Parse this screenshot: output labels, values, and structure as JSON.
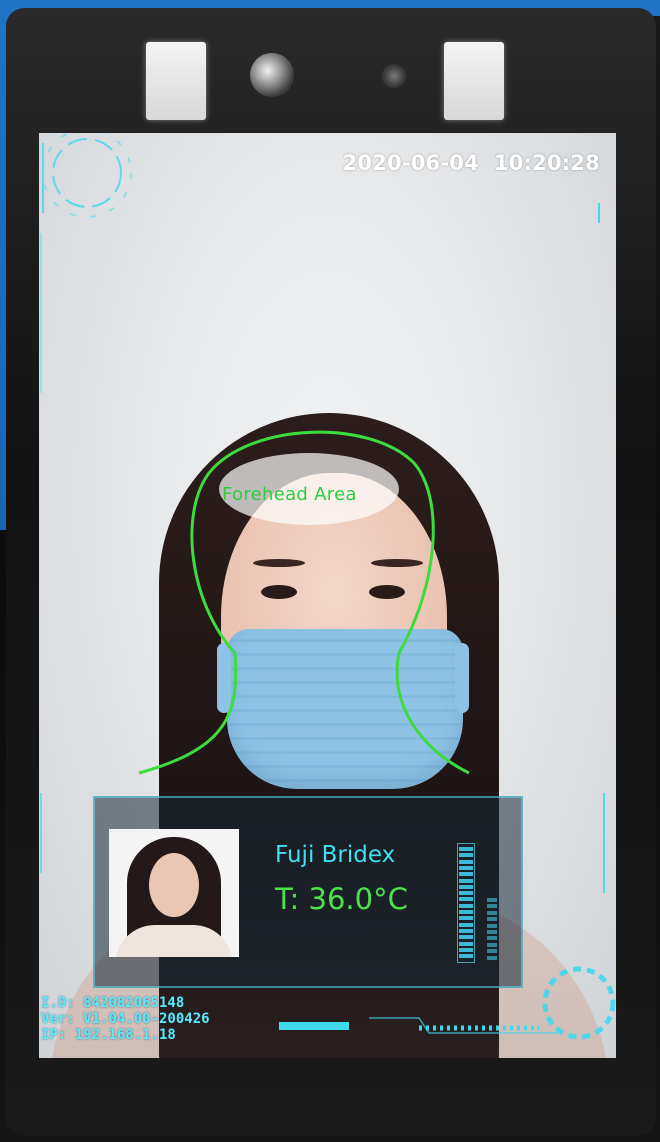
{
  "screen": {
    "timestamp": "2020-06-04  10:20:28",
    "forehead_label": "Forehead Area"
  },
  "recognition": {
    "name": "Fuji Bridex",
    "temperature": "T: 36.0°C"
  },
  "device_info": {
    "id_line": "I.D: 842082065148",
    "version_line": "Ver: V1.04.00-200426",
    "ip_line": "IP: 192.168.1.18"
  },
  "colors": {
    "accent_cyan": "#3fe0f2",
    "accent_green": "#4be34b",
    "frame_blue": "#1f74c9"
  },
  "icons": {
    "camera": "camera-lens-icon",
    "ir_sensor": "ir-sensor-icon",
    "face_guide": "face-outline-icon"
  }
}
